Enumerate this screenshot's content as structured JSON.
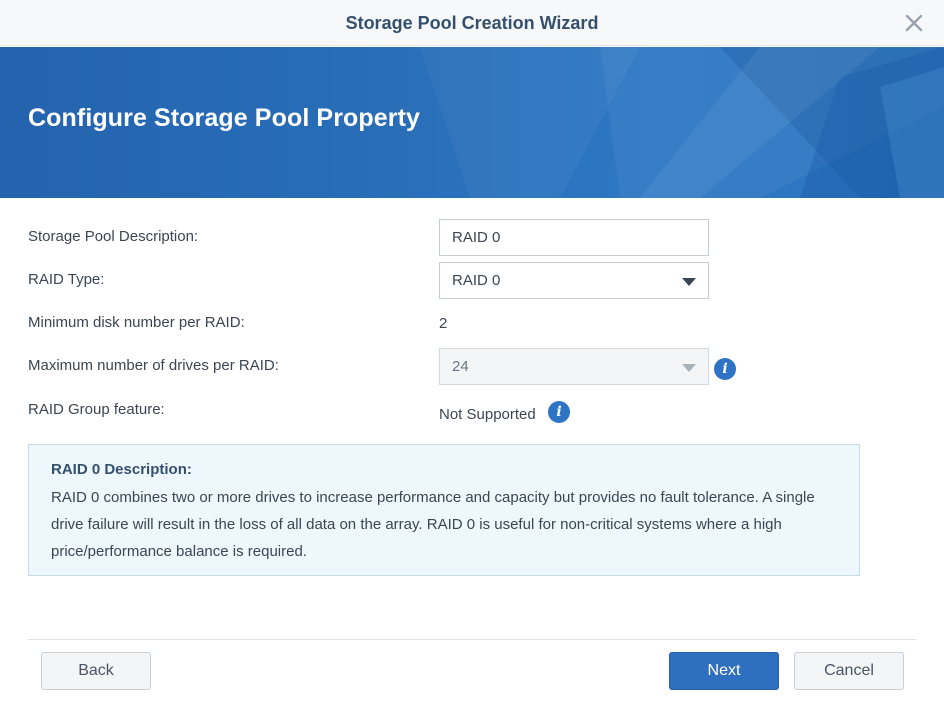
{
  "window": {
    "title": "Storage Pool Creation Wizard"
  },
  "banner": {
    "heading": "Configure Storage Pool Property"
  },
  "form": {
    "description": {
      "label": "Storage Pool Description:",
      "value": "RAID 0"
    },
    "raid_type": {
      "label": "RAID Type:",
      "selected": "RAID 0"
    },
    "min_disk": {
      "label": "Minimum disk number per RAID:",
      "value": "2"
    },
    "max_drives": {
      "label": "Maximum number of drives per RAID:",
      "selected": "24"
    },
    "raid_group": {
      "label": "RAID Group feature:",
      "value": "Not Supported"
    }
  },
  "info_box": {
    "title": "RAID 0 Description:",
    "text": "RAID 0 combines two or more drives to increase performance and capacity but provides no fault tolerance. A single drive failure will result in the loss of all data on the array. RAID 0 is useful for non-critical systems where a high price/performance balance is required."
  },
  "buttons": {
    "back": "Back",
    "next": "Next",
    "cancel": "Cancel"
  },
  "icons": {
    "close": "close-icon",
    "info": "info-icon",
    "dropdown": "chevron-down-icon"
  },
  "colors": {
    "banner": "#2a6fb9",
    "primary_button": "#2f6fbf",
    "info_icon": "#2e73c4",
    "info_box_bg": "#eef7fc"
  }
}
